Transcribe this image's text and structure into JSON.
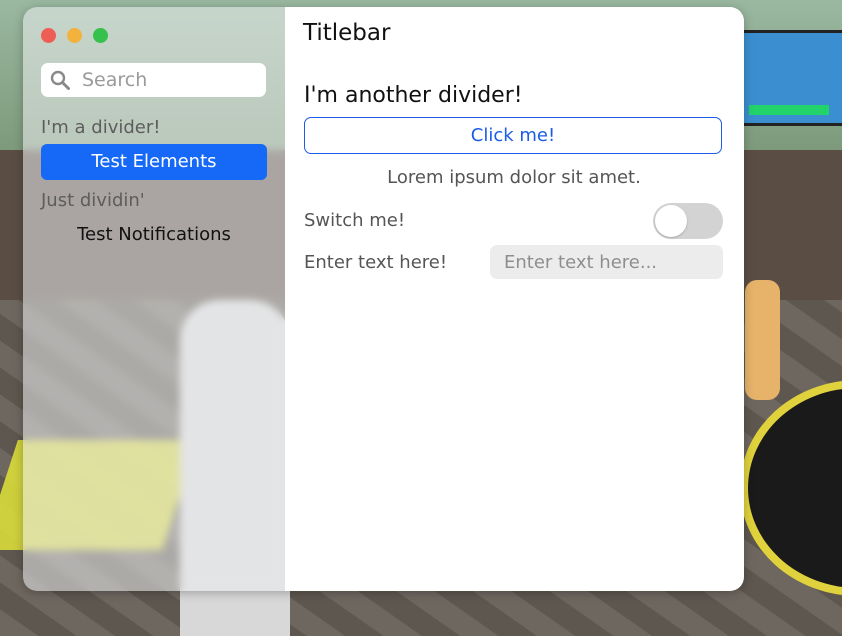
{
  "window": {
    "title": "Titlebar",
    "traffic_lights": [
      "close",
      "minimize",
      "maximize"
    ],
    "colors": {
      "close": "#ee5e55",
      "minimize": "#f3b23e",
      "maximize": "#35c14b",
      "accent": "#1668f7"
    }
  },
  "sidebar": {
    "search": {
      "placeholder": "Search",
      "value": ""
    },
    "entries": [
      {
        "type": "divider",
        "label": "I'm a divider!"
      },
      {
        "type": "item",
        "label": "Test Elements",
        "selected": true
      },
      {
        "type": "divider",
        "label": "Just dividin'"
      },
      {
        "type": "item",
        "label": "Test Notifications",
        "selected": false
      }
    ]
  },
  "main": {
    "divider_heading": "I'm another divider!",
    "button_label": "Click me!",
    "lorem_text": "Lorem ipsum dolor sit amet.",
    "switch": {
      "label": "Switch me!",
      "on": false
    },
    "text_input": {
      "label": "Enter text here!",
      "placeholder": "Enter text here...",
      "value": ""
    }
  }
}
